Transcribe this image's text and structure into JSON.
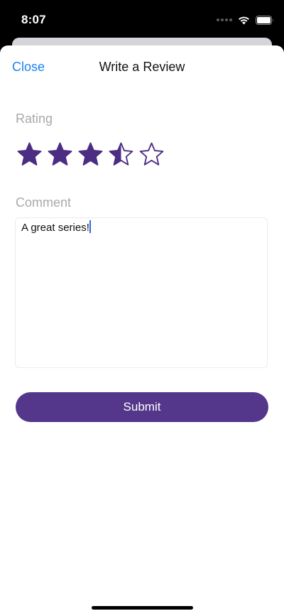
{
  "status_bar": {
    "time": "8:07",
    "icons": [
      "cellular-dots-icon",
      "wifi-icon",
      "battery-icon"
    ]
  },
  "nav": {
    "close_label": "Close",
    "title": "Write a Review"
  },
  "rating": {
    "label": "Rating",
    "value": 3.5,
    "max": 5,
    "star_color": "#4b2e83"
  },
  "comment": {
    "label": "Comment",
    "value": "A great series!"
  },
  "submit": {
    "label": "Submit",
    "color": "#54378a"
  },
  "colors": {
    "link": "#1a82f5",
    "label_gray": "#a9a9ad",
    "caret": "#2f63f0"
  }
}
